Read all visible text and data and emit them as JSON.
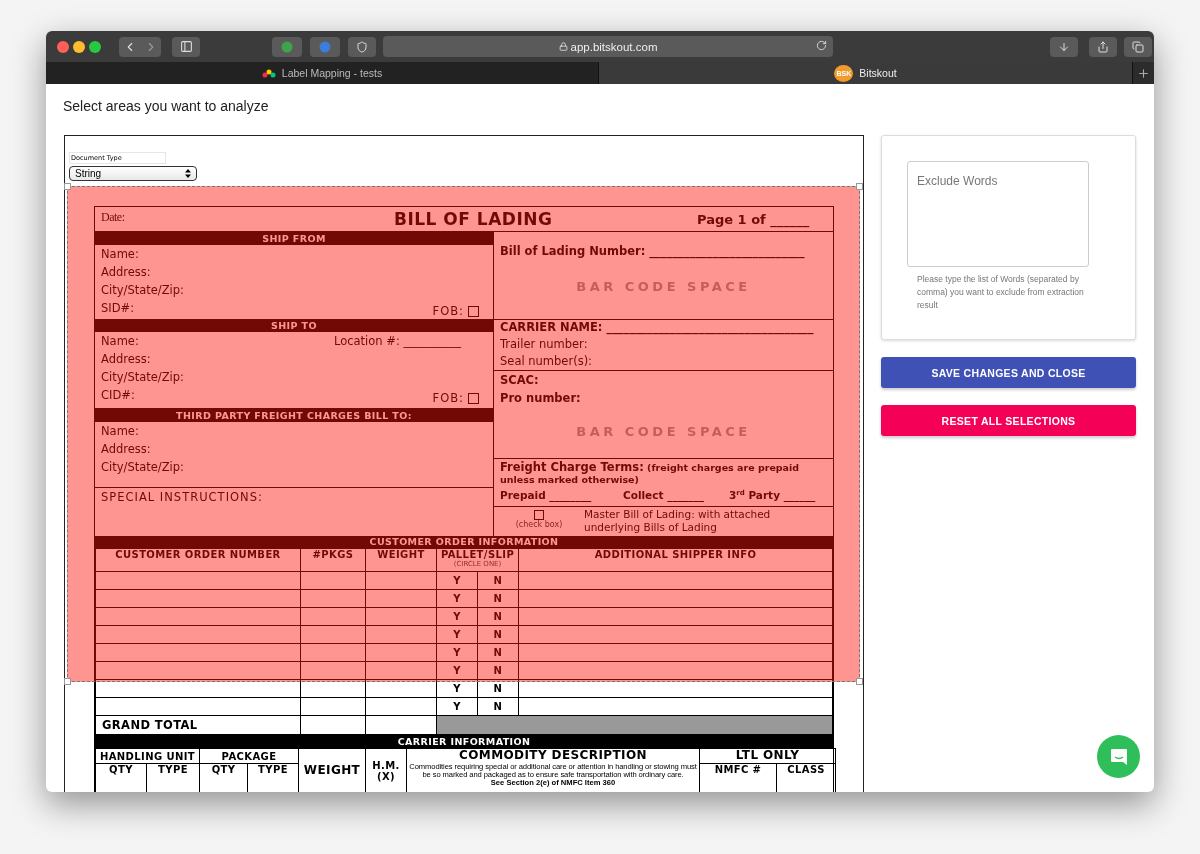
{
  "browser": {
    "url": "app.bitskout.com",
    "tabs": [
      {
        "label": "Label Mapping - tests",
        "selected": false,
        "kind": "logo"
      },
      {
        "label": "Bitskout",
        "selected": true,
        "kind": "badge",
        "badge_text": "BSK"
      }
    ]
  },
  "page_title": "Select areas you want to analyze",
  "document": {
    "type_field": {
      "label": "Document Type",
      "value": "String"
    },
    "header": {
      "date": "Date:",
      "title": "BILL OF LADING",
      "page": "Page 1 of ______"
    },
    "ship_from": {
      "heading": "SHIP FROM",
      "lines": [
        "Name:",
        "Address:",
        "City/State/Zip:",
        "SID#:"
      ],
      "fob": {
        "label": "FOB:",
        "checked": false
      }
    },
    "ship_to": {
      "heading": "SHIP TO",
      "lines": [
        "Name:",
        "Address:",
        "City/State/Zip:",
        "CID#:"
      ],
      "location": "Location #: __________",
      "fob": {
        "label": "FOB:",
        "checked": false
      }
    },
    "third_party": {
      "heading": "THIRD PARTY FREIGHT CHARGES BILL TO:",
      "lines": [
        "Name:",
        "Address:",
        "City/State/Zip:"
      ]
    },
    "special_instructions": "SPECIAL INSTRUCTIONS:",
    "bol_number": "Bill of Lading Number: ___________________________",
    "barcodes": [
      "BAR CODE SPACE",
      "BAR CODE SPACE"
    ],
    "carrier": {
      "name": "CARRIER NAME: ____________________________________",
      "trailer": "Trailer number:",
      "seal": "Seal number(s):"
    },
    "scac": "SCAC:",
    "pro_number": "Pro number:",
    "freight_terms": {
      "label": "Freight Charge Terms:",
      "note": "(freight charges are prepaid unless marked otherwise)",
      "options": [
        "Prepaid ________",
        "Collect _______",
        "3$^{rd}$ Party ______"
      ]
    },
    "master_bol": {
      "checked": false,
      "hint": "(check box)",
      "text": "Master Bill of Lading: with attached underlying Bills of Lading"
    },
    "customer_orders": {
      "heading": "CUSTOMER ORDER INFORMATION",
      "columns": [
        "CUSTOMER ORDER NUMBER",
        "#PKGS",
        "WEIGHT",
        "PALLET/SLIP",
        "ADDITIONAL SHIPPER INFO"
      ],
      "pallet_hint": "(CIRCLE ONE)",
      "rows": [
        {
          "yes": "Y",
          "no": "N"
        },
        {
          "yes": "Y",
          "no": "N"
        },
        {
          "yes": "Y",
          "no": "N"
        },
        {
          "yes": "Y",
          "no": "N"
        },
        {
          "yes": "Y",
          "no": "N"
        },
        {
          "yes": "Y",
          "no": "N"
        },
        {
          "yes": "Y",
          "no": "N"
        },
        {
          "yes": "Y",
          "no": "N"
        }
      ],
      "grand_total": "GRAND TOTAL"
    },
    "carrier_info": {
      "heading": "CARRIER INFORMATION",
      "groups": [
        "HANDLING UNIT",
        "PACKAGE"
      ],
      "sub_columns": [
        "QTY",
        "TYPE",
        "QTY",
        "TYPE"
      ],
      "weight": "WEIGHT",
      "hm": "H.M. (X)",
      "commodity": "COMMODITY DESCRIPTION",
      "commodity_note": "Commodities requiring special or additional care or attention in handling or stowing must be so marked and packaged as to ensure safe transportation with ordinary care.",
      "commodity_ref": "See Section 2(e) of NMFC Item 360",
      "ltl": "LTL ONLY",
      "nmfc": "NMFC #",
      "class": "CLASS"
    }
  },
  "exclude_words": {
    "placeholder": "Exclude Words",
    "helper": "Please type the list of Words (separated by comma) you want to exclude from extraction result"
  },
  "buttons": [
    {
      "label": "SAVE CHANGES AND CLOSE",
      "kind": "primary"
    },
    {
      "label": "RESET ALL SELECTIONS",
      "kind": "danger"
    }
  ]
}
